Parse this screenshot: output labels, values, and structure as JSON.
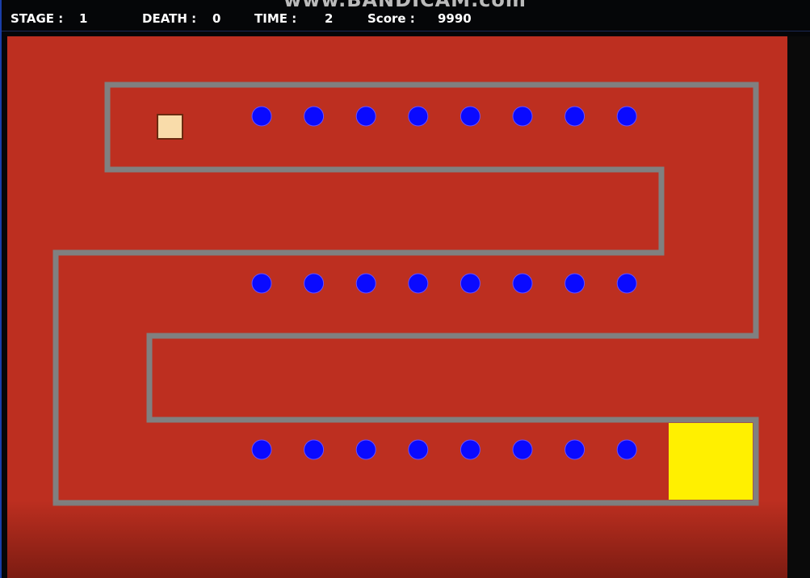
{
  "watermark": "www.BANDICAM.com",
  "hud": {
    "stage_label": "STAGE :",
    "stage_value": "1",
    "death_label": "DEATH :",
    "death_value": "0",
    "time_label": "TIME :",
    "time_value": "2",
    "score_label": "Score :",
    "score_value": "9990"
  },
  "colors": {
    "background": "#bd2f20",
    "wall": "#808080",
    "enemy": "#0a0aff",
    "player": "#f9dcaa",
    "goal": "#fff000"
  },
  "enemies": {
    "rows": 3,
    "per_row": 8
  }
}
